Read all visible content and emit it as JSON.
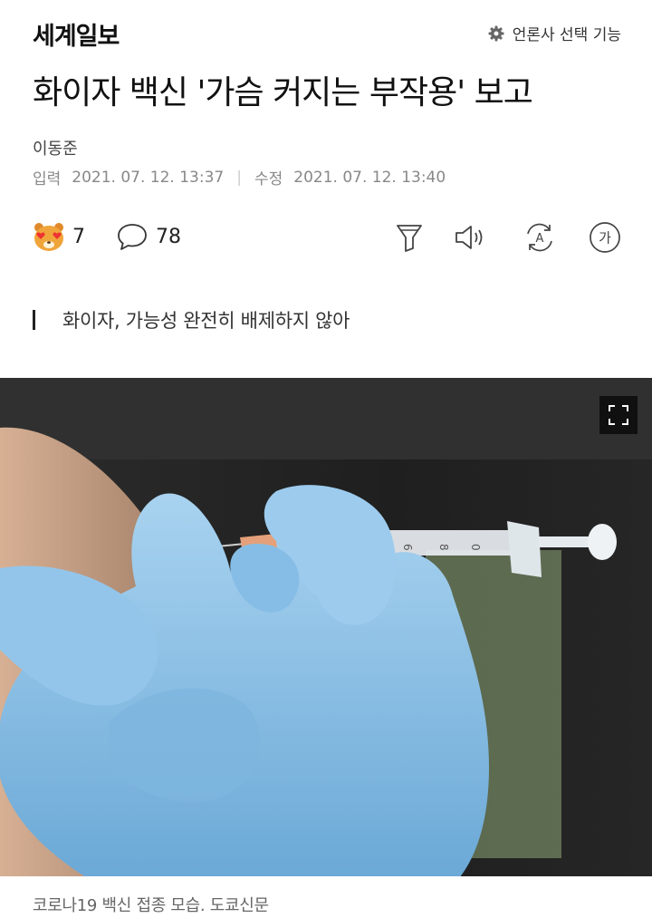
{
  "header": {
    "logo": "세계일보",
    "press_select_label": "언론사 선택 기능"
  },
  "article": {
    "headline": "화이자 백신 '가슴 커지는 부작용' 보고",
    "author": "이동준",
    "input_label": "입력",
    "input_date": "2021. 07. 12. 13:37",
    "modified_label": "수정",
    "modified_date": "2021. 07. 12. 13:40",
    "subtitle": "화이자, 가능성 완전히 배제하지 않아",
    "photo_caption": "코로나19 백신 접종 모습. 도쿄신문"
  },
  "toolbar": {
    "reaction_count": "7",
    "comment_count": "78",
    "icons": [
      "reaction-emoji-icon",
      "comment-icon",
      "summary-icon",
      "tts-audio-icon",
      "translate-icon",
      "font-size-icon"
    ],
    "font_size_glyph": "가",
    "translate_glyph": "A"
  },
  "photo": {
    "expand_icon": "fullscreen-icon",
    "description_colors": {
      "glove": "#8fc3e8",
      "background": "#262626",
      "skin": "#c9a287"
    }
  }
}
